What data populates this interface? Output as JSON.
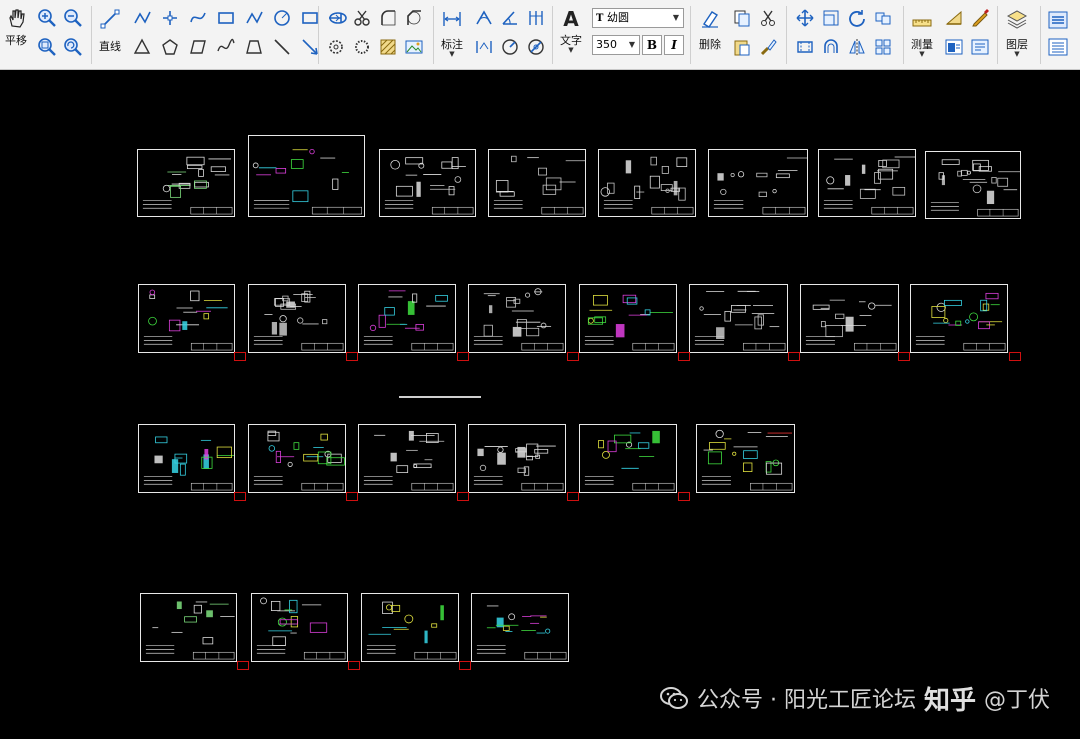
{
  "toolbar": {
    "pan_label": "平移",
    "line_label": "直线",
    "dimension_label": "标注",
    "text_label": "文字",
    "font_name": "幼圆",
    "font_size": "350",
    "bold_label": "B",
    "italic_label": "I",
    "delete_label": "删除",
    "measure_label": "测量",
    "layer_label": "图层"
  },
  "watermark": {
    "source": "公众号 · 阳光工匠论坛",
    "platform": "知乎",
    "author": "@丁伏"
  },
  "colors": {
    "toolbar_bg": "#f3f3f3",
    "canvas_bg": "#000000",
    "sheet_border": "#e8e8e8",
    "marker_red": "#d01010",
    "icon_blue": "#1e62c0"
  }
}
